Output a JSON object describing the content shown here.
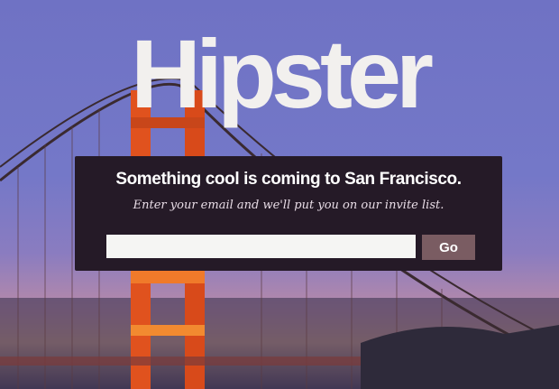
{
  "hero": {
    "title": "Hipster"
  },
  "signup": {
    "headline": "Something cool is coming to San Francisco.",
    "subtext": "Enter your email and we'll put you on our invite list.",
    "email_value": "",
    "go_label": "Go"
  },
  "colors": {
    "panel": "#251a27",
    "button": "#7a5c62",
    "sky": "#7074c6",
    "tower": "#e0521e"
  }
}
